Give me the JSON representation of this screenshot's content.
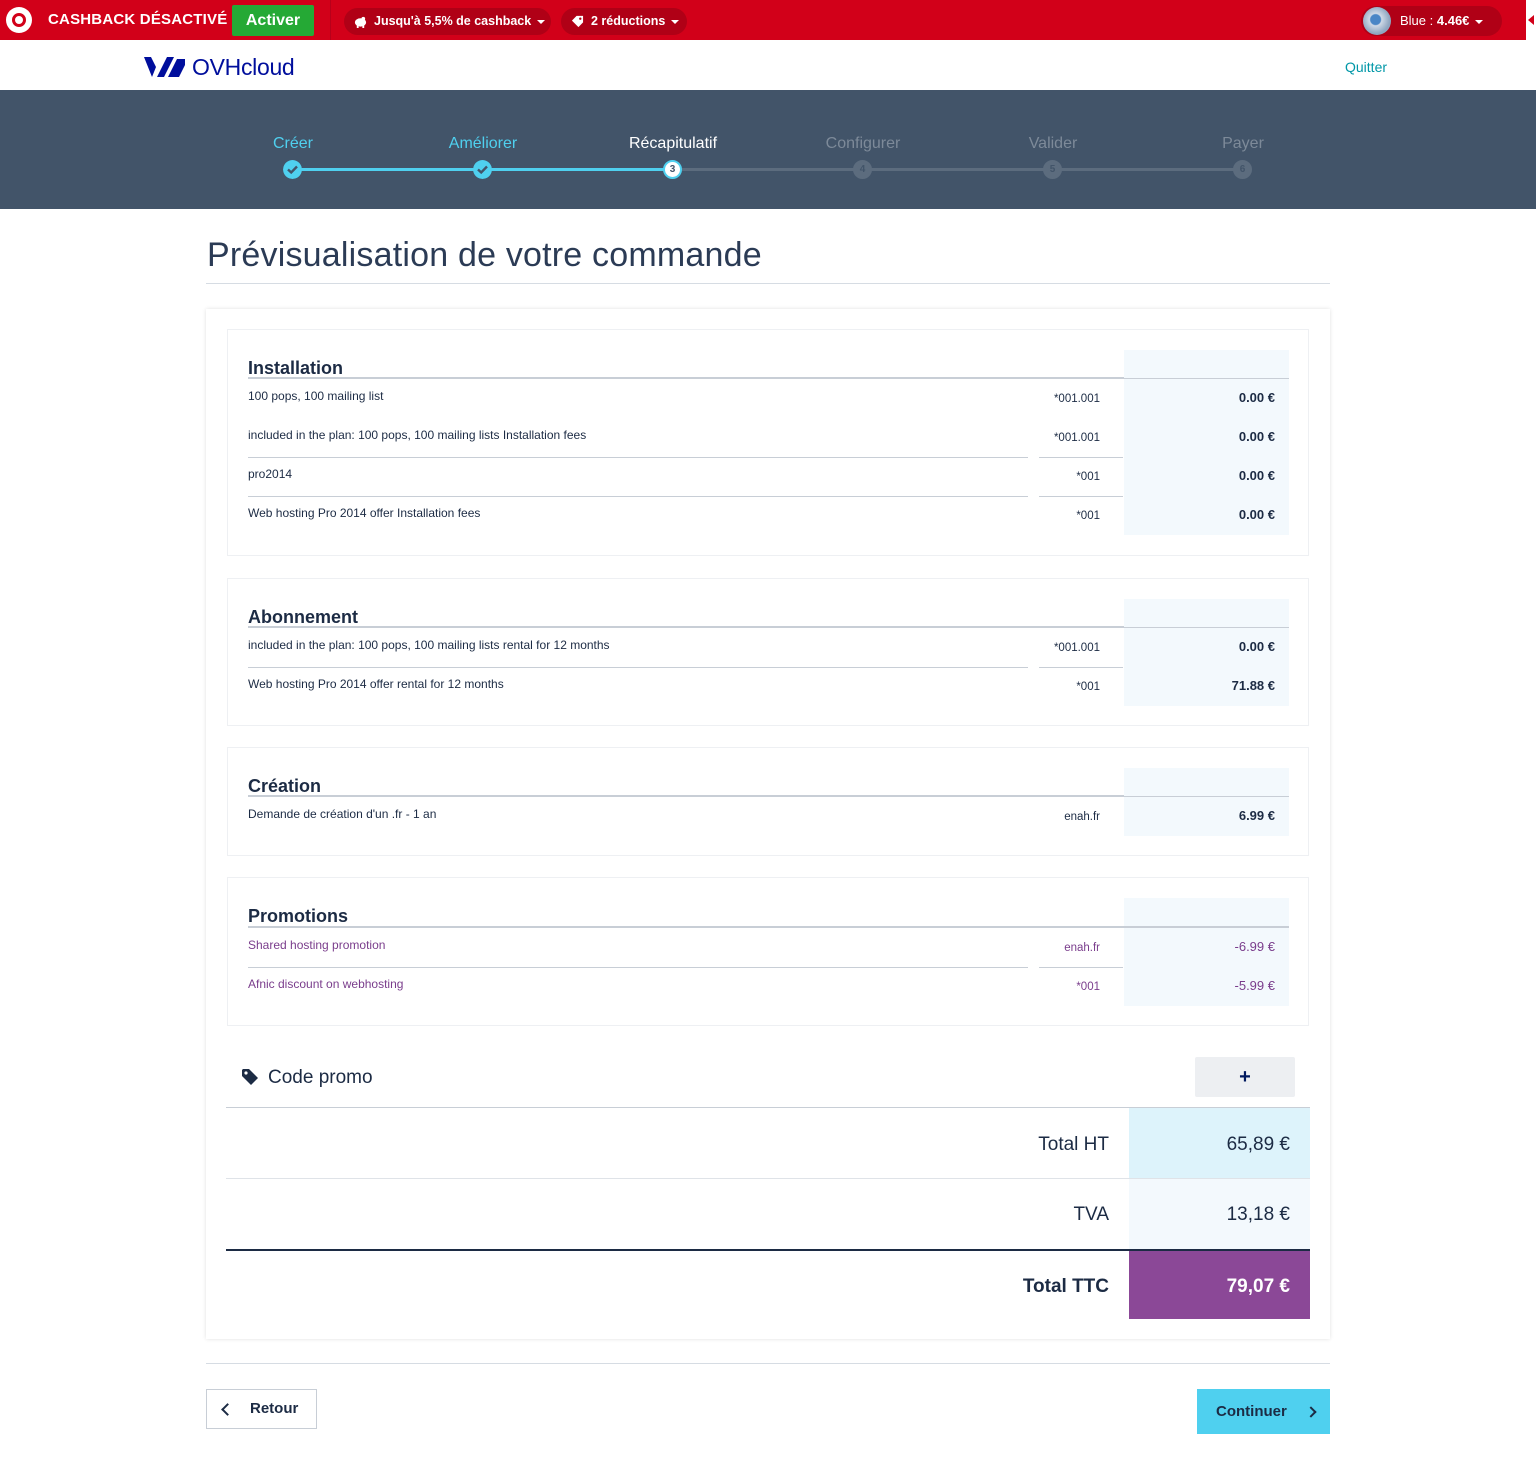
{
  "cashback_bar": {
    "status": "CASHBACK DÉSACTIVÉ",
    "activate_label": "Activer",
    "cashback_rate_label": "Jusqu'à 5,5% de cashback",
    "discounts_label": "2 réductions",
    "user_prefix": "Blue :",
    "user_balance": "4.46€",
    "accent_color": "#d20019",
    "activate_color": "#25a935"
  },
  "header": {
    "logo_text": "OVHcloud",
    "quit_label": "Quitter"
  },
  "stepper": {
    "steps": [
      {
        "label": "Créer",
        "state": "done"
      },
      {
        "label": "Améliorer",
        "state": "done"
      },
      {
        "label": "Récapitulatif",
        "state": "current",
        "number": "3"
      },
      {
        "label": "Configurer",
        "state": "pending",
        "number": "4"
      },
      {
        "label": "Valider",
        "state": "pending",
        "number": "5"
      },
      {
        "label": "Payer",
        "state": "pending",
        "number": "6"
      }
    ]
  },
  "page_title": "Prévisualisation de votre commande",
  "sections": [
    {
      "title": "Installation",
      "rows": [
        {
          "description": "100 pops, 100 mailing list",
          "reference": "*001.001",
          "price": "0.00 €"
        },
        {
          "description": "included in the plan: 100 pops, 100 mailing lists Installation fees",
          "reference": "*001.001",
          "price": "0.00 €"
        },
        {
          "description": "pro2014",
          "reference": "*001",
          "price": "0.00 €"
        },
        {
          "description": "Web hosting Pro 2014 offer Installation fees",
          "reference": "*001",
          "price": "0.00 €"
        }
      ]
    },
    {
      "title": "Abonnement",
      "rows": [
        {
          "description": "included in the plan: 100 pops, 100 mailing lists rental for 12 months",
          "reference": "*001.001",
          "price": "0.00 €"
        },
        {
          "description": "Web hosting Pro 2014 offer rental for 12 months",
          "reference": "*001",
          "price": "71.88 €"
        }
      ]
    },
    {
      "title": "Création",
      "rows": [
        {
          "description": "Demande de création d'un .fr - 1 an",
          "reference": "enah.fr",
          "price": "6.99 €"
        }
      ]
    },
    {
      "title": "Promotions",
      "rows": [
        {
          "description": "Shared hosting promotion",
          "reference": "enah.fr",
          "price": "-6.99 €"
        },
        {
          "description": "Afnic discount on webhosting",
          "reference": "*001",
          "price": "-5.99 €"
        }
      ]
    }
  ],
  "promo_code": {
    "label": "Code promo",
    "add_label": "+"
  },
  "totals": {
    "ht_label": "Total HT",
    "ht_value": "65,89 €",
    "tva_label": "TVA",
    "tva_value": "13,18 €",
    "ttc_label": "Total TTC",
    "ttc_value": "79,07 €",
    "ttc_color": "#8b4897"
  },
  "navigation": {
    "back_label": "Retour",
    "next_label": "Continuer"
  }
}
